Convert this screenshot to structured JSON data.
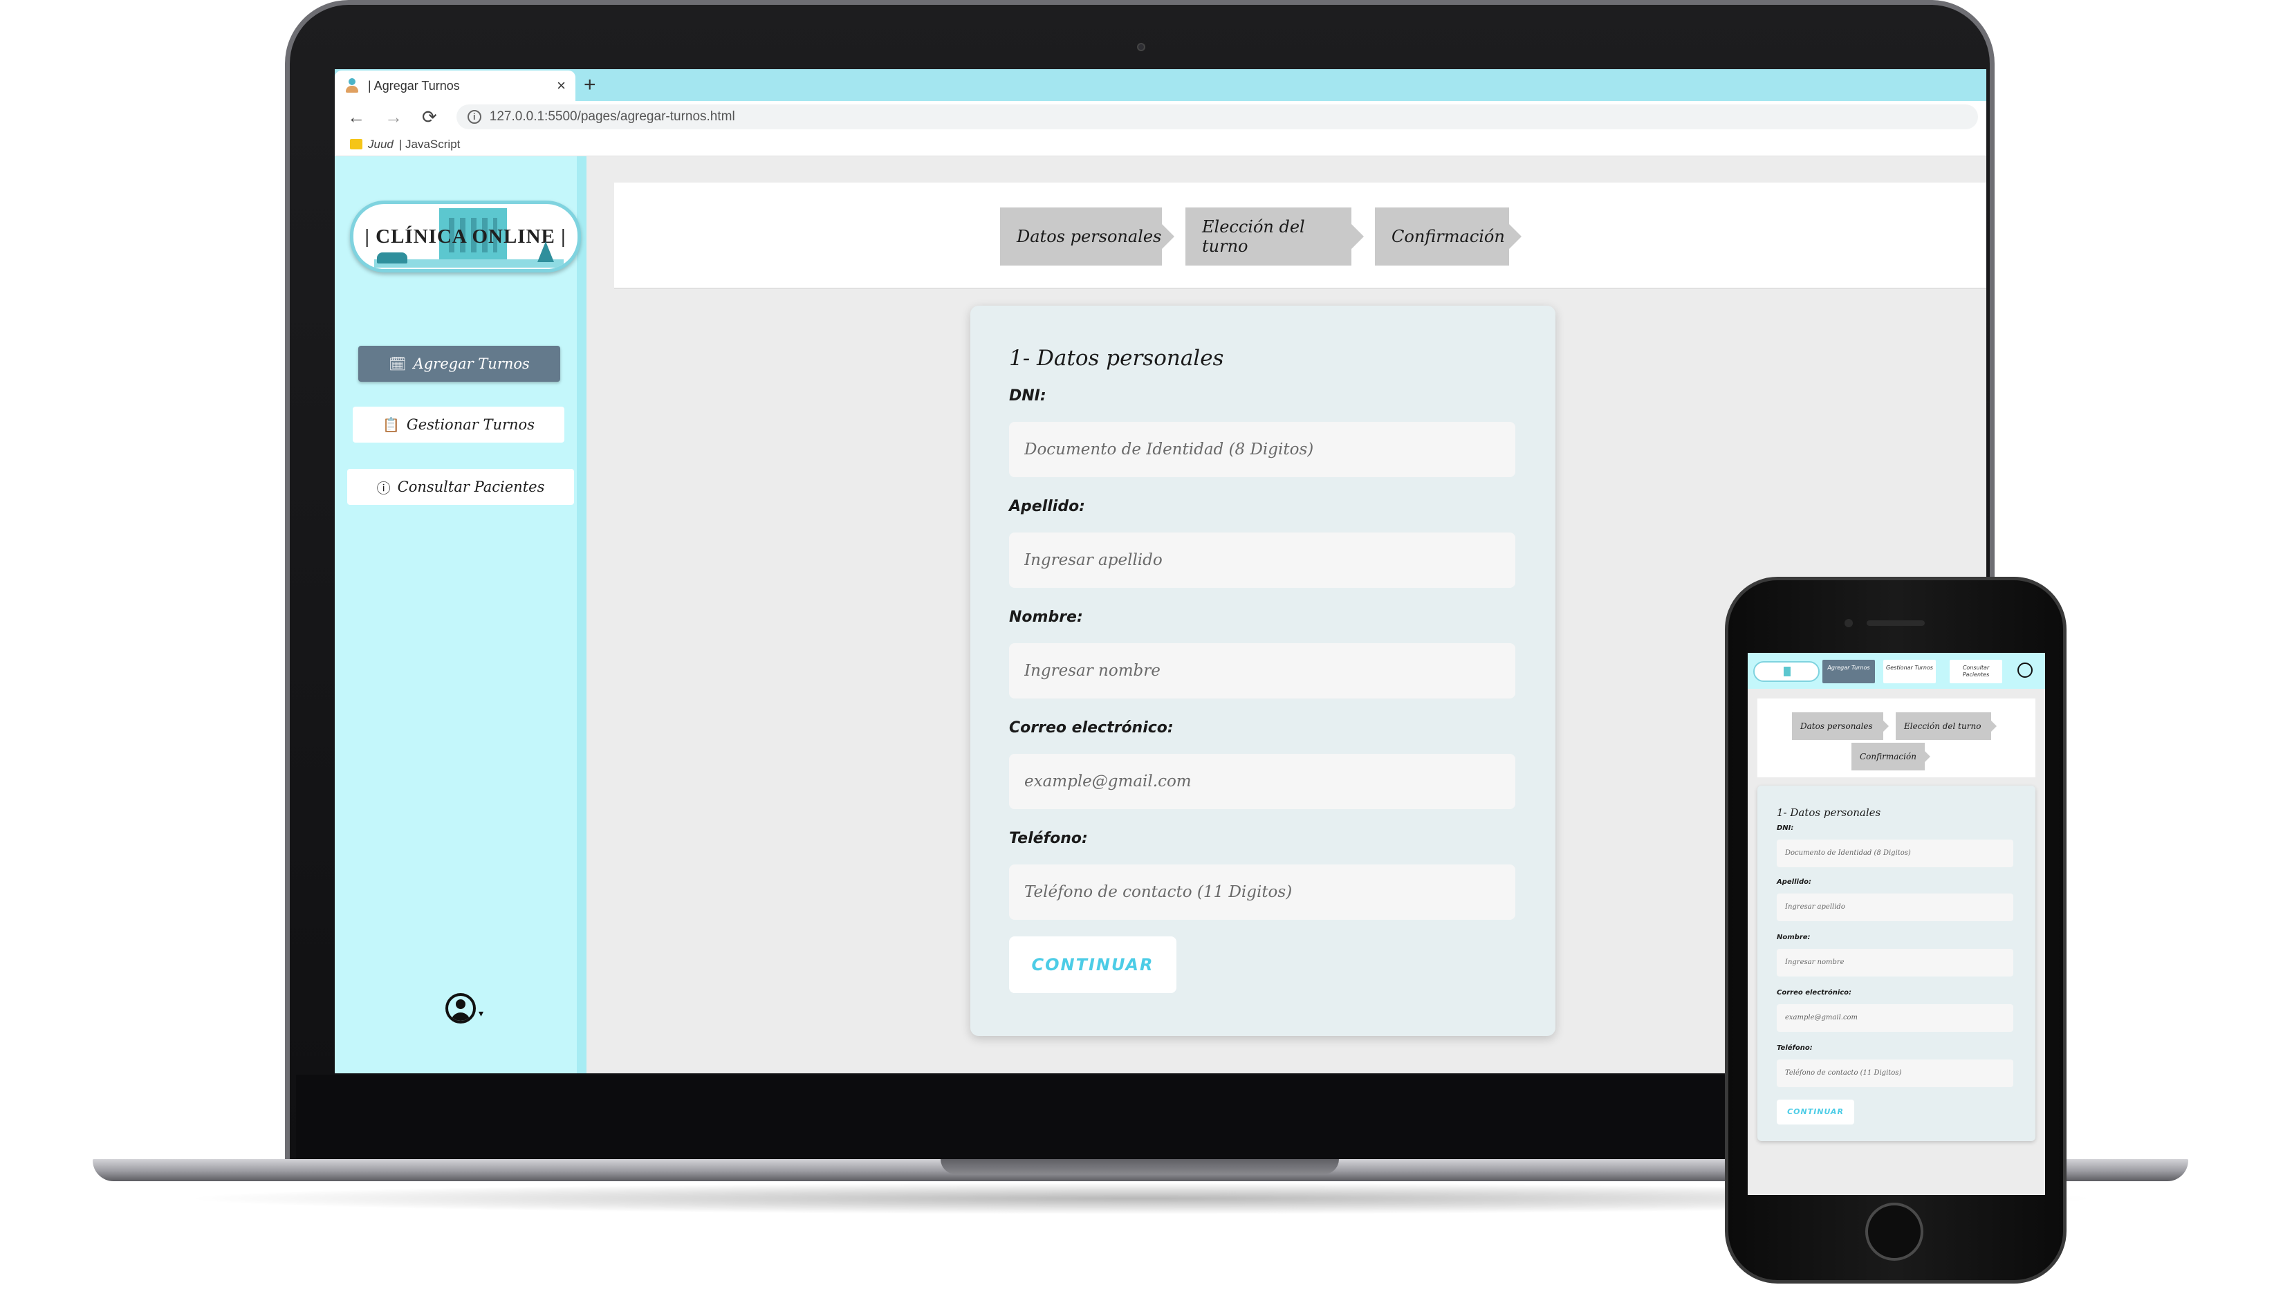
{
  "browser": {
    "tab_title": "| Agregar Turnos",
    "tab_close": "×",
    "new_tab": "+",
    "url": "127.0.0.1:5500/pages/agregar-turnos.html",
    "bookmarks": [
      "Juud",
      "| JavaScript"
    ]
  },
  "brand": {
    "logo_text": "| CLÍNICA ONLINE |",
    "sidebar_bg": "#c4f7fb",
    "active_button": "#647a8c",
    "accent": "#4ccce6"
  },
  "sidebar": {
    "items": [
      {
        "label": "Agregar Turnos",
        "icon": "calendar-plus-icon",
        "active": true
      },
      {
        "label": "Gestionar Turnos",
        "icon": "clipboard-icon",
        "active": false
      },
      {
        "label": "Consultar Pacientes",
        "icon": "info-circle-icon",
        "active": false
      }
    ],
    "user_icon": "user-circle-icon"
  },
  "steps": [
    "Datos personales",
    "Elección del turno",
    "Confirmación"
  ],
  "form": {
    "title": "1- Datos personales",
    "fields": [
      {
        "label": "DNI:",
        "placeholder": "Documento de Identidad (8 Digitos)"
      },
      {
        "label": "Apellido:",
        "placeholder": "Ingresar apellido"
      },
      {
        "label": "Nombre:",
        "placeholder": "Ingresar nombre"
      },
      {
        "label": "Correo electrónico:",
        "placeholder": "example@gmail.com"
      },
      {
        "label": "Teléfono:",
        "placeholder": "Teléfono de contacto (11 Digitos)"
      }
    ],
    "submit_label": "CONTINUAR"
  },
  "mobile": {
    "nav": [
      "Agregar Turnos",
      "Gestionar Turnos",
      "Consultar Pacientes"
    ]
  }
}
